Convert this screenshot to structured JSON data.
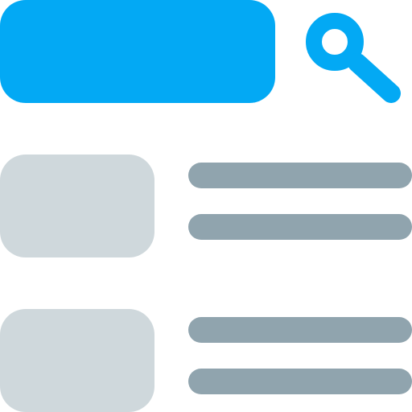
{
  "colors": {
    "accent": "#03a9f4",
    "thumbnail": "#cfd8dc",
    "text_line": "#90a4ae",
    "background": "#ffffff"
  },
  "header": {
    "search_bar": {
      "placeholder": ""
    },
    "search_button": {
      "icon": "search-icon"
    }
  },
  "results": [
    {
      "thumbnail": "image-placeholder",
      "lines": [
        "text-placeholder",
        "text-placeholder"
      ]
    },
    {
      "thumbnail": "image-placeholder",
      "lines": [
        "text-placeholder",
        "text-placeholder"
      ]
    }
  ]
}
